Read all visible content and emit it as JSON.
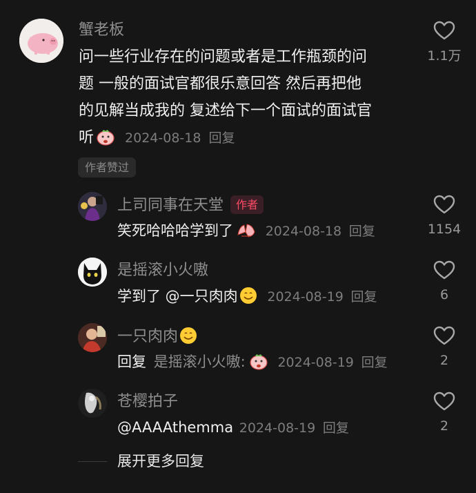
{
  "main_comment": {
    "username": "蟹老板",
    "lines": [
      "问一些行业存在的问题或者是工作瓶颈的问",
      "题 一般的面试官都很乐意回答 然后再把他",
      "的见解当成我的 复述给下一个面试的面试官",
      "听"
    ],
    "date": "2024-08-18",
    "reply_label": "回复",
    "like_count": "1.1万",
    "author_liked": "作者赞过",
    "sticker_icon": "cartoon-face-sticker"
  },
  "replies": [
    {
      "username": "上司同事在天堂",
      "badge": "作者",
      "text": "笑死哈哈哈学到了",
      "date": "2024-08-18",
      "reply_label": "回复",
      "like_count": "1154"
    },
    {
      "username": "是摇滚小火嗷",
      "text": "学到了 @一只肉肉",
      "date": "2024-08-19",
      "reply_label": "回复",
      "like_count": "6"
    },
    {
      "username": "一只肉肉",
      "prefix": "回复",
      "reply_to": "是摇滚小火嗷:",
      "date": "2024-08-19",
      "reply_label": "回复",
      "like_count": "2"
    },
    {
      "username": "苍樱拍子",
      "text": "@AAAAthemma",
      "date": "2024-08-19",
      "reply_label": "回复",
      "like_count": "2"
    }
  ],
  "expand_more": "展开更多回复",
  "colors": {
    "background": "#161616",
    "muted_text": "#8e8e8e",
    "author_badge": "#ff4b66"
  }
}
